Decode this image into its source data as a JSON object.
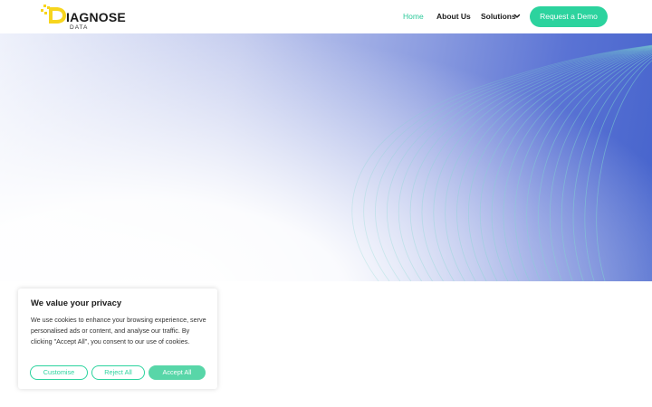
{
  "brand": {
    "name": "IAGNOSE",
    "subtitle": "DATA",
    "logo_icon": "diagnose-data-logo",
    "accent_color": "#2cd39e",
    "logo_color": "#f7d51e"
  },
  "nav": {
    "items": [
      {
        "label": "Home",
        "active": true
      },
      {
        "label": "About Us",
        "active": false
      },
      {
        "label": "Solutions",
        "active": false,
        "icon": "chevron-down-icon"
      }
    ],
    "cta_label": "Request a Demo"
  },
  "hero": {
    "background_colors": [
      "#ffffff",
      "#8b9ce0",
      "#4563cc"
    ],
    "wave_color": "#7fd8d0"
  },
  "cookie_banner": {
    "title": "We value your privacy",
    "text": "We use cookies to enhance your browsing experience, serve personalised ads or content, and analyse our traffic. By clicking \"Accept All\", you consent to our use of cookies.",
    "buttons": {
      "customise": "Customise",
      "reject": "Reject All",
      "accept": "Accept All"
    }
  }
}
